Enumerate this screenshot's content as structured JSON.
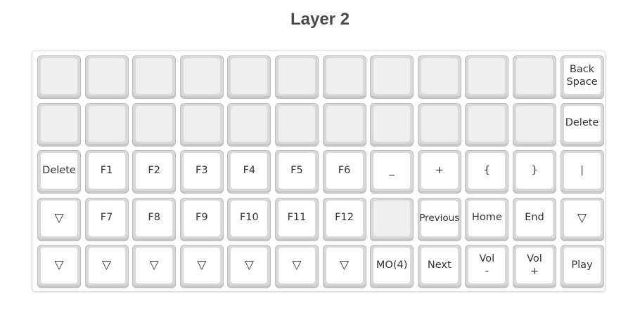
{
  "title": "Layer 2",
  "rows": [
    [
      "",
      "",
      "",
      "",
      "",
      "",
      "",
      "",
      "",
      "",
      "",
      "Back\nSpace"
    ],
    [
      "",
      "",
      "",
      "",
      "",
      "",
      "",
      "",
      "",
      "",
      "",
      "Delete"
    ],
    [
      "Delete",
      "F1",
      "F2",
      "F3",
      "F4",
      "F5",
      "F6",
      "_",
      "+",
      "{",
      "}",
      "|"
    ],
    [
      "▽",
      "F7",
      "F8",
      "F9",
      "F10",
      "F11",
      "F12",
      "",
      "Previous",
      "Home",
      "End",
      "▽"
    ],
    [
      "▽",
      "▽",
      "▽",
      "▽",
      "▽",
      "▽",
      "▽",
      "MO(4)",
      "Next",
      "Vol\n-",
      "Vol\n+",
      "Play"
    ]
  ]
}
